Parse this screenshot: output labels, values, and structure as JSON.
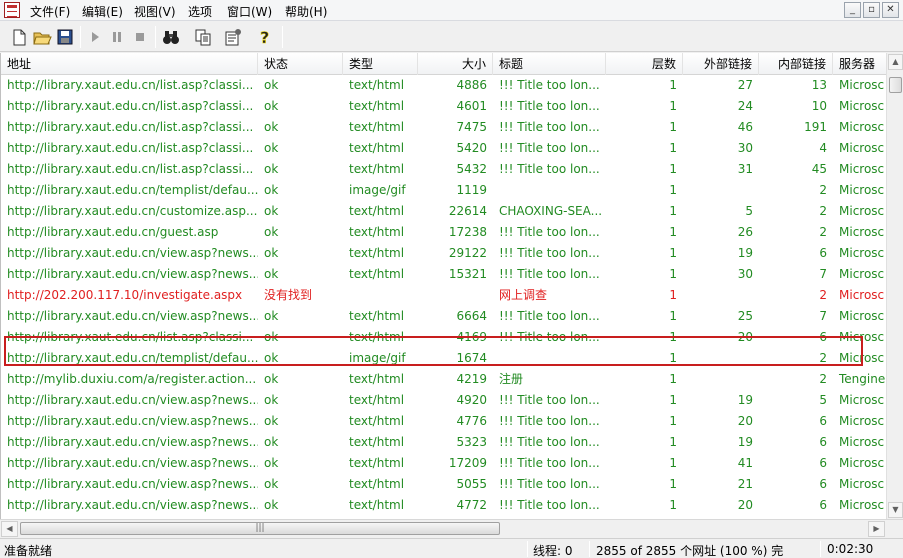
{
  "menu": {
    "items": [
      "文件(F)",
      "编辑(E)",
      "视图(V)",
      "选项",
      "窗口(W)",
      "帮助(H)"
    ]
  },
  "window_controls": [
    "_",
    "▫",
    "✕"
  ],
  "toolbar": {
    "icons": [
      "new-file-icon",
      "open-folder-icon",
      "save-icon",
      "play-icon",
      "pause-icon",
      "stop-icon",
      "binoculars-icon",
      "copy-icon",
      "properties-icon",
      "help-icon"
    ]
  },
  "table": {
    "headers": {
      "url": "地址",
      "status": "状态",
      "type": "类型",
      "size": "大小",
      "title": "标题",
      "level": "层数",
      "external": "外部链接",
      "internal": "内部链接",
      "server": "服务器"
    },
    "rows": [
      {
        "url": "http://library.xaut.edu.cn/list.asp?classi...",
        "status": "ok",
        "type": "text/html",
        "size": "4886",
        "title": "!!! Title too lon...",
        "level": "1",
        "external": "27",
        "internal": "13",
        "server": "Microsc",
        "error": false
      },
      {
        "url": "http://library.xaut.edu.cn/list.asp?classi...",
        "status": "ok",
        "type": "text/html",
        "size": "4601",
        "title": "!!! Title too lon...",
        "level": "1",
        "external": "24",
        "internal": "10",
        "server": "Microsc",
        "error": false
      },
      {
        "url": "http://library.xaut.edu.cn/list.asp?classi...",
        "status": "ok",
        "type": "text/html",
        "size": "7475",
        "title": "!!! Title too lon...",
        "level": "1",
        "external": "46",
        "internal": "191",
        "server": "Microsc",
        "error": false
      },
      {
        "url": "http://library.xaut.edu.cn/list.asp?classi...",
        "status": "ok",
        "type": "text/html",
        "size": "5420",
        "title": "!!! Title too lon...",
        "level": "1",
        "external": "30",
        "internal": "4",
        "server": "Microsc",
        "error": false
      },
      {
        "url": "http://library.xaut.edu.cn/list.asp?classi...",
        "status": "ok",
        "type": "text/html",
        "size": "5432",
        "title": "!!! Title too lon...",
        "level": "1",
        "external": "31",
        "internal": "45",
        "server": "Microsc",
        "error": false
      },
      {
        "url": "http://library.xaut.edu.cn/templist/defau...",
        "status": "ok",
        "type": "image/gif",
        "size": "1119",
        "title": "",
        "level": "1",
        "external": "",
        "internal": "2",
        "server": "Microsc",
        "error": false
      },
      {
        "url": "http://library.xaut.edu.cn/customize.asp...",
        "status": "ok",
        "type": "text/html",
        "size": "22614",
        "title": "CHAOXING-SEA...",
        "level": "1",
        "external": "5",
        "internal": "2",
        "server": "Microsc",
        "error": false
      },
      {
        "url": "http://library.xaut.edu.cn/guest.asp",
        "status": "ok",
        "type": "text/html",
        "size": "17238",
        "title": "!!! Title too lon...",
        "level": "1",
        "external": "26",
        "internal": "2",
        "server": "Microsc",
        "error": false
      },
      {
        "url": "http://library.xaut.edu.cn/view.asp?news...",
        "status": "ok",
        "type": "text/html",
        "size": "29122",
        "title": "!!! Title too lon...",
        "level": "1",
        "external": "19",
        "internal": "6",
        "server": "Microsc",
        "error": false
      },
      {
        "url": "http://library.xaut.edu.cn/view.asp?news...",
        "status": "ok",
        "type": "text/html",
        "size": "15321",
        "title": "!!! Title too lon...",
        "level": "1",
        "external": "30",
        "internal": "7",
        "server": "Microsc",
        "error": false
      },
      {
        "url": "http://202.200.117.10/investigate.aspx",
        "status": "没有找到",
        "type": "",
        "size": "",
        "title": "网上调查",
        "level": "1",
        "external": "",
        "internal": "2",
        "server": "Microsc",
        "error": true
      },
      {
        "url": "http://library.xaut.edu.cn/view.asp?news...",
        "status": "ok",
        "type": "text/html",
        "size": "6664",
        "title": "!!! Title too lon...",
        "level": "1",
        "external": "25",
        "internal": "7",
        "server": "Microsc",
        "error": false
      },
      {
        "url": "http://library.xaut.edu.cn/list.asp?classi...",
        "status": "ok",
        "type": "text/html",
        "size": "4169",
        "title": "!!! Title too lon...",
        "level": "1",
        "external": "20",
        "internal": "6",
        "server": "Microsc",
        "error": false
      },
      {
        "url": "http://library.xaut.edu.cn/templist/defau...",
        "status": "ok",
        "type": "image/gif",
        "size": "1674",
        "title": "",
        "level": "1",
        "external": "",
        "internal": "2",
        "server": "Microsc",
        "error": false
      },
      {
        "url": "http://mylib.duxiu.com/a/register.action...",
        "status": "ok",
        "type": "text/html",
        "size": "4219",
        "title": "注册",
        "level": "1",
        "external": "",
        "internal": "2",
        "server": "Tengine",
        "error": false
      },
      {
        "url": "http://library.xaut.edu.cn/view.asp?news...",
        "status": "ok",
        "type": "text/html",
        "size": "4920",
        "title": "!!! Title too lon...",
        "level": "1",
        "external": "19",
        "internal": "5",
        "server": "Microsc",
        "error": false
      },
      {
        "url": "http://library.xaut.edu.cn/view.asp?news...",
        "status": "ok",
        "type": "text/html",
        "size": "4776",
        "title": "!!! Title too lon...",
        "level": "1",
        "external": "20",
        "internal": "6",
        "server": "Microsc",
        "error": false
      },
      {
        "url": "http://library.xaut.edu.cn/view.asp?news...",
        "status": "ok",
        "type": "text/html",
        "size": "5323",
        "title": "!!! Title too lon...",
        "level": "1",
        "external": "19",
        "internal": "6",
        "server": "Microsc",
        "error": false
      },
      {
        "url": "http://library.xaut.edu.cn/view.asp?news...",
        "status": "ok",
        "type": "text/html",
        "size": "17209",
        "title": "!!! Title too lon...",
        "level": "1",
        "external": "41",
        "internal": "6",
        "server": "Microsc",
        "error": false
      },
      {
        "url": "http://library.xaut.edu.cn/view.asp?news...",
        "status": "ok",
        "type": "text/html",
        "size": "5055",
        "title": "!!! Title too lon...",
        "level": "1",
        "external": "21",
        "internal": "6",
        "server": "Microsc",
        "error": false
      },
      {
        "url": "http://library.xaut.edu.cn/view.asp?news...",
        "status": "ok",
        "type": "text/html",
        "size": "4772",
        "title": "!!! Title too lon...",
        "level": "1",
        "external": "20",
        "internal": "6",
        "server": "Microsc",
        "error": false
      }
    ]
  },
  "scrollbar": {
    "thumb_grip": "|||"
  },
  "statusbar": {
    "ready": "准备就绪",
    "threads": "线程: 0",
    "progress": "2855 of 2855 个网址 (100 %) 完",
    "elapsed": "0:02:30"
  },
  "colors": {
    "ok_text": "#228b22",
    "error_text": "#e02020",
    "highlight_border": "#c81e1e"
  }
}
